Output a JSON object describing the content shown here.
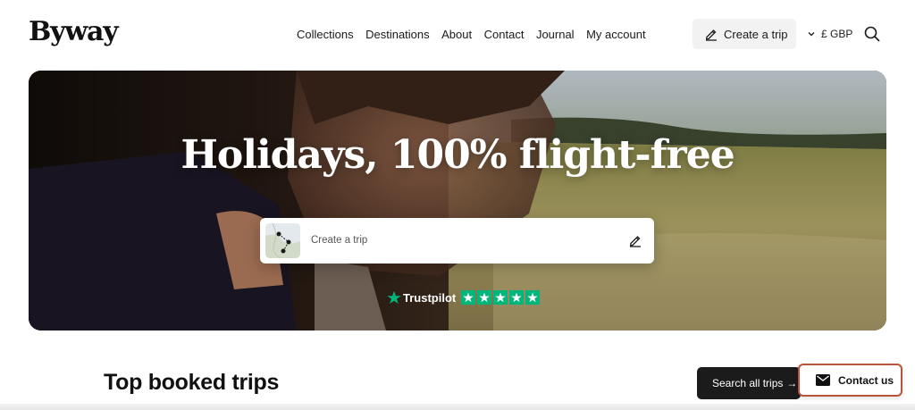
{
  "header": {
    "logo": "Byway",
    "nav": [
      "Collections",
      "Destinations",
      "About",
      "Contact",
      "Journal",
      "My account"
    ],
    "create_trip_label": "Create a trip",
    "currency": "£ GBP"
  },
  "hero": {
    "title": "Holidays, 100% flight-free",
    "search_placeholder": "Create a trip",
    "trustpilot_label": "Trustpilot",
    "trustpilot_stars": 5
  },
  "section": {
    "title": "Top booked trips",
    "search_all_label": "Search all trips",
    "search_all_arrow": "→"
  },
  "contact": {
    "label": "Contact us"
  },
  "colors": {
    "accent_border": "#b8543a",
    "trustpilot_green": "#00b67a",
    "dark_button": "#1b1b1b"
  }
}
